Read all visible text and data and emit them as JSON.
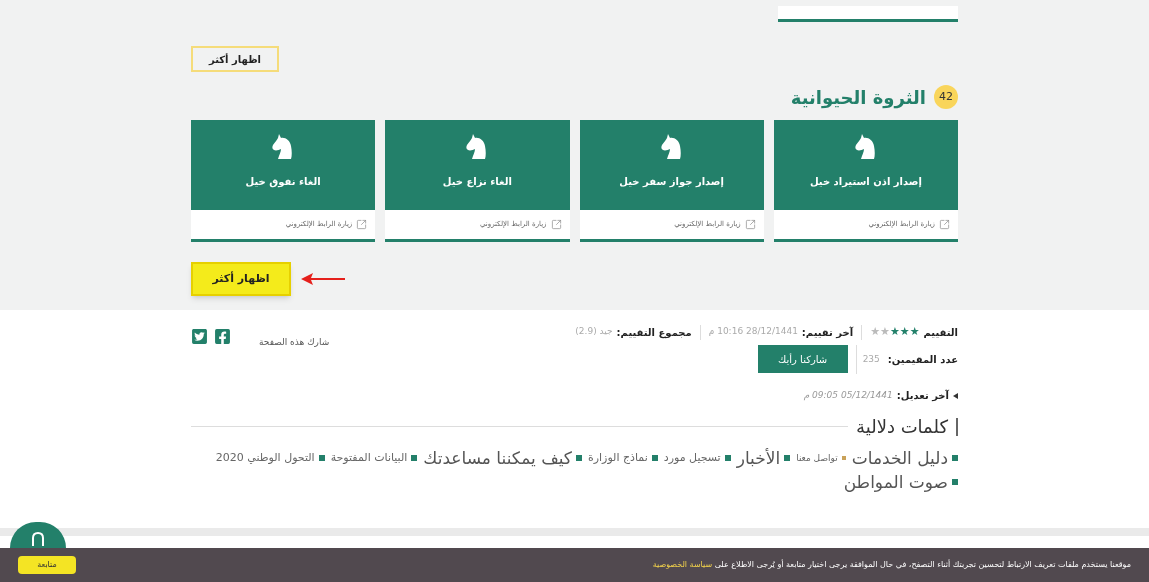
{
  "top_button": {
    "label": "اظهار أكثر",
    "kind": "outline"
  },
  "section": {
    "badge": "42",
    "title": "الثروة الحيوانية"
  },
  "services": [
    {
      "title": "إصدار اذن استيراد خيل",
      "link": "زيارة الرابط الإلكتروني"
    },
    {
      "title": "إصدار جواز سفر خيل",
      "link": "زيارة الرابط الإلكتروني"
    },
    {
      "title": "الغاء نزاع خيل",
      "link": "زيارة الرابط الإلكتروني"
    },
    {
      "title": "الغاء نفوق خيل",
      "link": "زيارة الرابط الإلكتروني"
    }
  ],
  "more_button": {
    "label": "اظهار أكثر",
    "kind": "highlighted"
  },
  "rating": {
    "label": "التقييم",
    "stars": 3,
    "last_label": "آخر تقييم:",
    "last_value": "28/12/1441 10:16 م",
    "total_label": "مجموع التقييم:",
    "total_value": "جيد (2.9)",
    "count_label": "عدد المقيمين:",
    "count_value": "235",
    "share_opinion": "شاركنا رأيك",
    "share_page": "شارك هذه الصفحة"
  },
  "modified": {
    "label": "آخر تعديل:",
    "value": "05/12/1441 09:05 م"
  },
  "keywords": {
    "title": "كلمات دلالية",
    "items": [
      {
        "text": "دليل الخدمات",
        "kind": "large"
      },
      {
        "text": "تواصل معنا",
        "kind": "tiny"
      },
      {
        "text": "الأخبار",
        "kind": "large"
      },
      {
        "text": "تسجيل مورد",
        "kind": "small"
      },
      {
        "text": "نماذج الوزارة",
        "kind": "small"
      },
      {
        "text": "كيف يمكننا مساعدتك",
        "kind": "large"
      },
      {
        "text": "البيانات المفتوحة",
        "kind": "small"
      },
      {
        "text": "التحول الوطني 2020",
        "kind": "small"
      },
      {
        "text": "صوت المواطن",
        "kind": "large"
      }
    ]
  },
  "cookie": {
    "text": "موقعنا يستخدم ملفات تعريف الارتباط لتحسين تجربتك أثناء التصفح، في حال الموافقة يرجى اختيار متابعة أو يُرجى الاطلاع على",
    "link": "سياسة الخصوصية",
    "button": "متابعة"
  }
}
